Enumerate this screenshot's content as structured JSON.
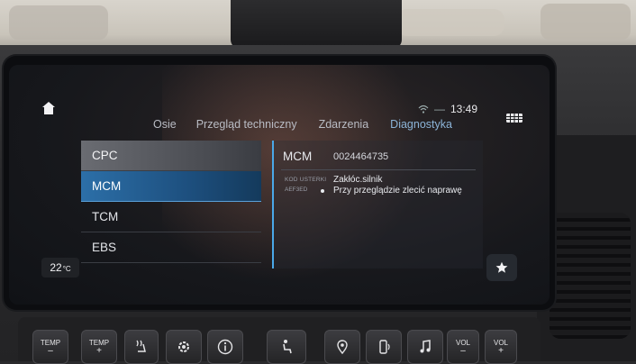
{
  "status": {
    "time": "13:49",
    "separator": "—"
  },
  "tabs": [
    {
      "label": "Osie"
    },
    {
      "label": "Przegląd techniczny"
    },
    {
      "label": "Zdarzenia"
    },
    {
      "label": "Diagnostyka",
      "active": true
    }
  ],
  "ecu_list": [
    {
      "label": "CPC"
    },
    {
      "label": "MCM",
      "selected": true
    },
    {
      "label": "TCM"
    },
    {
      "label": "EBS"
    }
  ],
  "detail": {
    "module": "MCM",
    "part_number": "0024464735",
    "error_label": "KOD USTERKI",
    "error_code": "AEF3ED",
    "error_title": "Zakłóc.silnik",
    "error_action": "Przy przeglądzie zlecić naprawę"
  },
  "climate": {
    "temperature": "22",
    "unit": "°C"
  },
  "hardware_buttons": {
    "temp_down": {
      "label": "TEMP",
      "sign": "–"
    },
    "temp_up": {
      "label": "TEMP",
      "sign": "+"
    },
    "vol_down": {
      "label": "VOL",
      "sign": "–"
    },
    "vol_up": {
      "label": "VOL",
      "sign": "+"
    }
  },
  "colors": {
    "accent": "#2c6fa8",
    "active_tab": "#8cb4d8",
    "divider": "#4aa8e8"
  }
}
